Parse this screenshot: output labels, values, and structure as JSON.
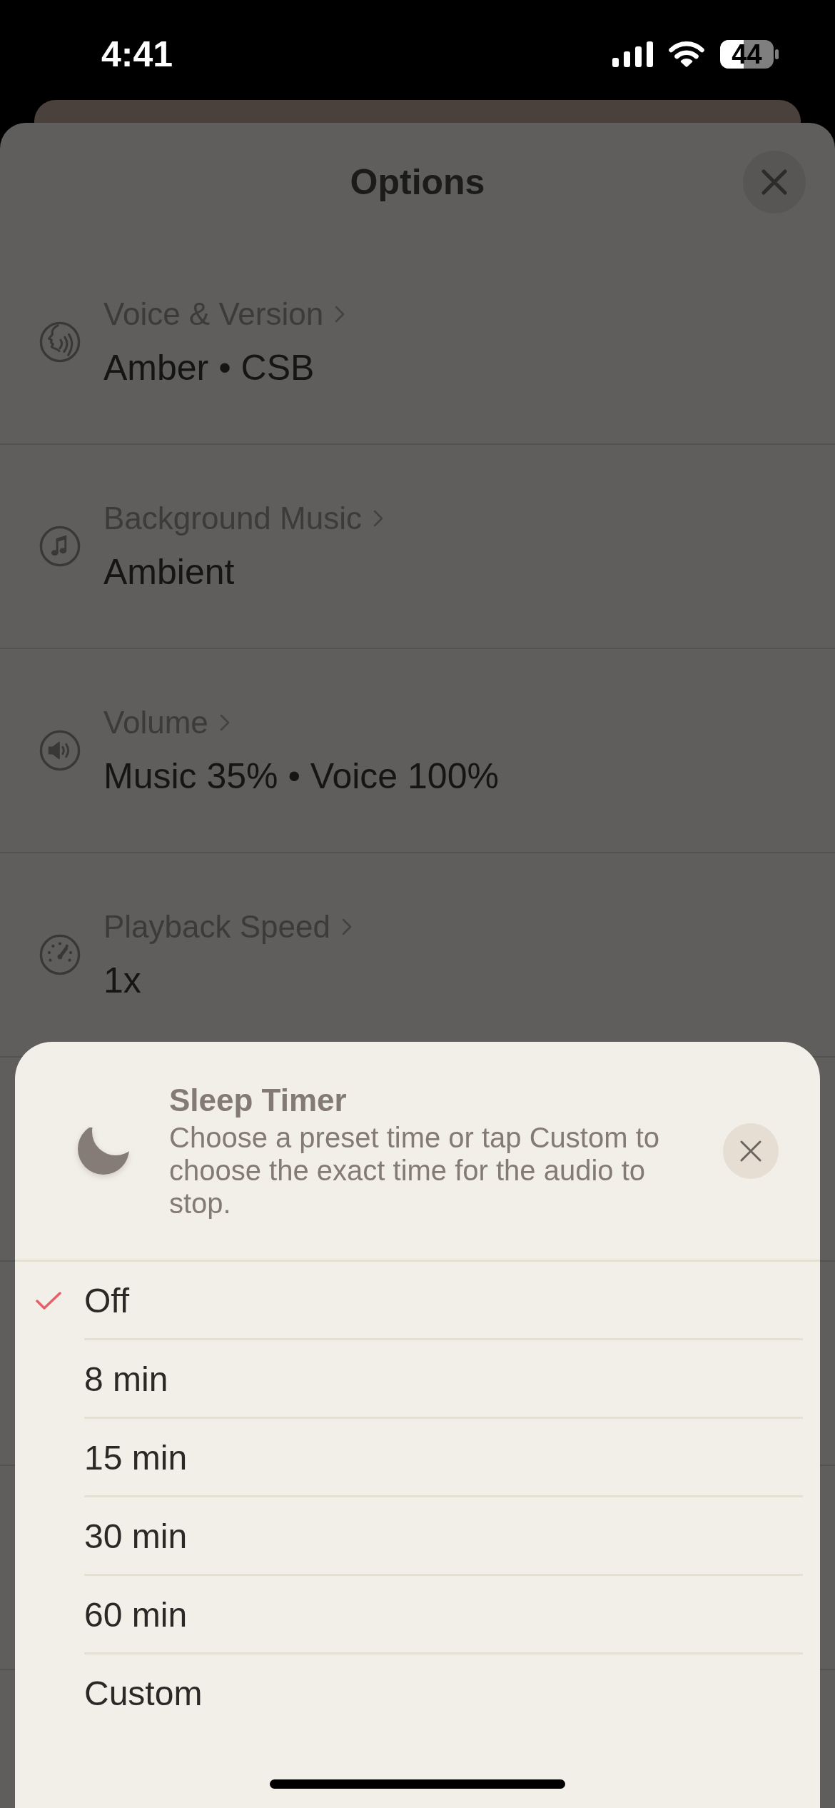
{
  "status_bar": {
    "time": "4:41",
    "battery_percent": "44"
  },
  "options": {
    "title": "Options",
    "rows": [
      {
        "kind": "voice",
        "label": "Voice & Version",
        "value": "Amber • CSB"
      },
      {
        "kind": "music",
        "label": "Background Music",
        "value": "Ambient"
      },
      {
        "kind": "volume",
        "label": "Volume",
        "value": "Music 35% • Voice 100%"
      },
      {
        "kind": "speed",
        "label": "Playback Speed",
        "value": "1x"
      }
    ]
  },
  "sleep_timer": {
    "title": "Sleep Timer",
    "description": "Choose a preset time or tap Custom to choose the exact time for the audio to stop.",
    "options": [
      {
        "label": "Off",
        "selected": true
      },
      {
        "label": "8 min",
        "selected": false
      },
      {
        "label": "15 min",
        "selected": false
      },
      {
        "label": "30 min",
        "selected": false
      },
      {
        "label": "60 min",
        "selected": false
      },
      {
        "label": "Custom",
        "selected": false
      }
    ]
  }
}
